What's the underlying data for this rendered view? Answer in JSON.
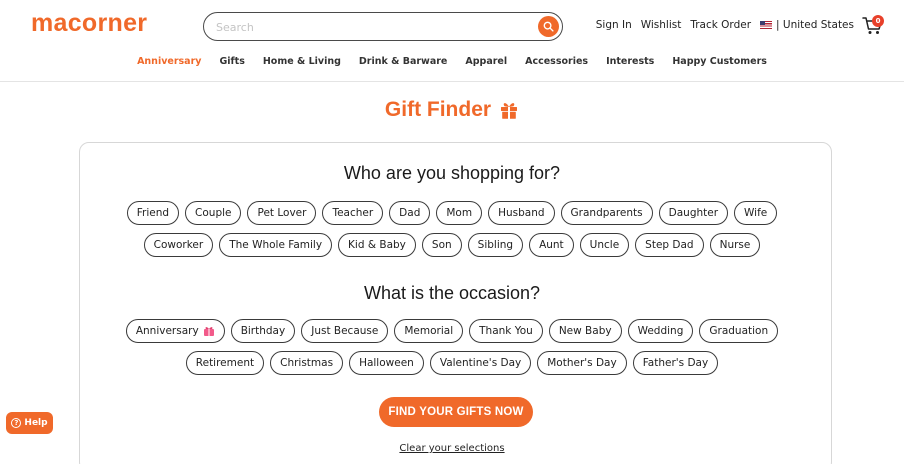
{
  "header": {
    "logo": "macorner",
    "search_placeholder": "Search",
    "links": [
      "Sign In",
      "Wishlist",
      "Track Order"
    ],
    "country": "| United States",
    "cart_count": "0"
  },
  "nav": {
    "items": [
      "Anniversary",
      "Gifts",
      "Home & Living",
      "Drink & Barware",
      "Apparel",
      "Accessories",
      "Interests",
      "Happy Customers"
    ],
    "active": "Anniversary"
  },
  "main": {
    "title": "Gift Finder",
    "question_recipient": "Who are you shopping for?",
    "recipients_row1": [
      "Friend",
      "Couple",
      "Pet Lover",
      "Teacher",
      "Dad",
      "Mom",
      "Husband",
      "Grandparents",
      "Daughter",
      "Wife"
    ],
    "recipients_row2": [
      "Coworker",
      "The Whole Family",
      "Kid & Baby",
      "Son",
      "Sibling",
      "Aunt",
      "Uncle",
      "Step Dad",
      "Nurse"
    ],
    "question_occasion": "What is the occasion?",
    "occasions_row1": [
      "Anniversary",
      "Birthday",
      "Just Because",
      "Memorial",
      "Thank You",
      "New Baby",
      "Wedding",
      "Graduation"
    ],
    "occasions_row2": [
      "Retirement",
      "Christmas",
      "Halloween",
      "Valentine's Day",
      "Mother's Day",
      "Father's Day"
    ],
    "find_button": "FIND YOUR GIFTS NOW",
    "clear_link": "Clear your selections"
  },
  "help": {
    "label": "Help"
  },
  "colors": {
    "accent": "#f0692a",
    "badge": "#e8402a"
  }
}
